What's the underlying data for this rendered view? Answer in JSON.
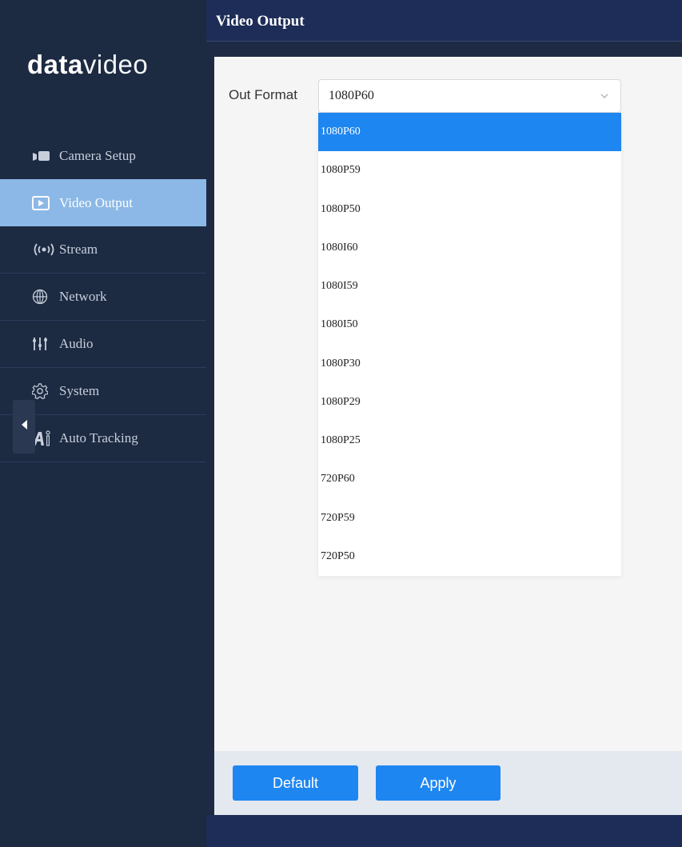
{
  "brand": {
    "logo_bold": "data",
    "logo_light": "video"
  },
  "sidebar": {
    "items": [
      {
        "label": "Camera Setup",
        "icon": "camera-icon"
      },
      {
        "label": "Video Output",
        "icon": "play-box-icon",
        "active": true
      },
      {
        "label": "Stream",
        "icon": "broadcast-icon"
      },
      {
        "label": "Network",
        "icon": "globe-icon"
      },
      {
        "label": "Audio",
        "icon": "sliders-icon"
      },
      {
        "label": "System",
        "icon": "gear-icon"
      },
      {
        "label": "Auto Tracking",
        "icon": "ai-icon"
      }
    ]
  },
  "header": {
    "title": "Video Output"
  },
  "form": {
    "out_format_label": "Out Format",
    "out_format_value": "1080P60",
    "options": [
      "1080P60",
      "1080P59",
      "1080P50",
      "1080I60",
      "1080I59",
      "1080I50",
      "1080P30",
      "1080P29",
      "1080P25",
      "720P60",
      "720P59",
      "720P50"
    ]
  },
  "buttons": {
    "default_label": "Default",
    "apply_label": "Apply"
  },
  "colors": {
    "accent": "#1e86f0",
    "sidebar_bg": "#1c2a42",
    "header_bg": "#1d2d57",
    "active_nav": "#8bb8e6"
  }
}
